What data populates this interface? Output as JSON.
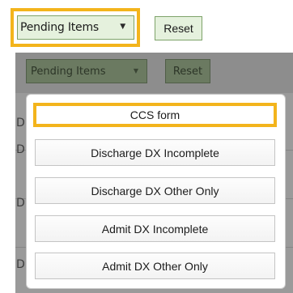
{
  "toolbar": {
    "filter_value": "Pending Items",
    "reset_label": "Reset",
    "dropdown_icon": "caret-down",
    "caret_glyph": "▼"
  },
  "background_toolbar": {
    "filter_value": "Pending Items",
    "reset_label": "Reset"
  },
  "background_rows": {
    "edge_glyph": "D"
  },
  "menu": {
    "items": [
      {
        "label": "CCS form",
        "active": true
      },
      {
        "label": "Discharge DX Incomplete",
        "active": false
      },
      {
        "label": "Discharge DX Other Only",
        "active": false
      },
      {
        "label": "Admit DX Incomplete",
        "active": false
      },
      {
        "label": "Admit DX Other Only",
        "active": false
      }
    ]
  },
  "colors": {
    "highlight": "#f3b41c",
    "button_fill": "#e5f1dd",
    "button_border": "#7ea36a",
    "overlay": "#9a9a9a"
  }
}
